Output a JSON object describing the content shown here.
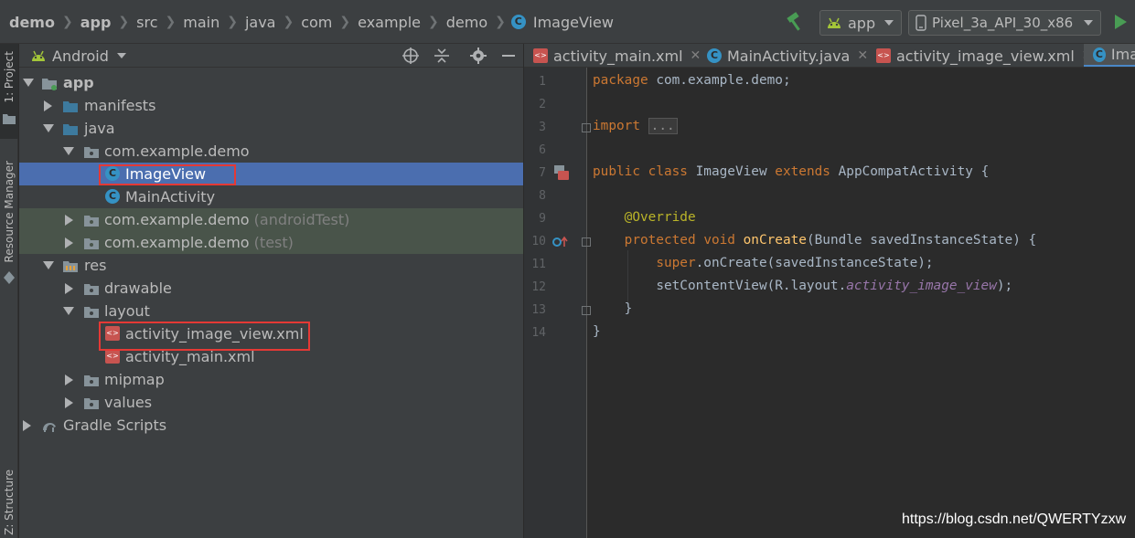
{
  "navbar": {
    "breadcrumbs": [
      "demo",
      "app",
      "src",
      "main",
      "java",
      "com",
      "example",
      "demo"
    ],
    "current_file": "ImageView",
    "run_config": "app",
    "device": "Pixel_3a_API_30_x86"
  },
  "tool_strip": {
    "project_tab": "1: Project",
    "resource_manager_tab": "Resource Manager",
    "structure_tab": "Z: Structure"
  },
  "project_panel": {
    "view_mode": "Android",
    "tree": [
      {
        "label": "app",
        "suffix": ""
      },
      {
        "label": "manifests",
        "suffix": ""
      },
      {
        "label": "java",
        "suffix": ""
      },
      {
        "label": "com.example.demo",
        "suffix": ""
      },
      {
        "label": "ImageView",
        "suffix": ""
      },
      {
        "label": "MainActivity",
        "suffix": ""
      },
      {
        "label": "com.example.demo",
        "suffix": " (androidTest)"
      },
      {
        "label": "com.example.demo",
        "suffix": " (test)"
      },
      {
        "label": "res",
        "suffix": ""
      },
      {
        "label": "drawable",
        "suffix": ""
      },
      {
        "label": "layout",
        "suffix": ""
      },
      {
        "label": "activity_image_view.xml",
        "suffix": ""
      },
      {
        "label": "activity_main.xml",
        "suffix": ""
      },
      {
        "label": "mipmap",
        "suffix": ""
      },
      {
        "label": "values",
        "suffix": ""
      },
      {
        "label": "Gradle Scripts",
        "suffix": ""
      }
    ],
    "selected_item": "ImageView"
  },
  "editor": {
    "tabs": [
      {
        "label": "activity_main.xml",
        "icon": "xml-file-icon"
      },
      {
        "label": "MainActivity.java",
        "icon": "java-class-icon"
      },
      {
        "label": "activity_image_view.xml",
        "icon": "xml-file-icon"
      },
      {
        "label": "Ima",
        "icon": "java-class-icon"
      }
    ],
    "line_numbers": [
      "1",
      "2",
      "3",
      "6",
      "7",
      "8",
      "9",
      "10",
      "11",
      "12",
      "13",
      "14"
    ],
    "code": {
      "l1_kw": "package",
      "l1_rest": " com.example.demo;",
      "l3_kw": "import",
      "l3_fold": "...",
      "l7_kw1": "public",
      "l7_kw2": "class",
      "l7_name": " ImageView ",
      "l7_kw3": "extends",
      "l7_rest": " AppCompatActivity {",
      "l9_ann": "@Override",
      "l10_kw1": "protected",
      "l10_kw2": "void",
      "l10_fn": "onCreate",
      "l10_rest": "(Bundle savedInstanceState) {",
      "l11_kw": "super",
      "l11_rest": ".onCreate(savedInstanceState);",
      "l12_pre": "setContentView(R.layout.",
      "l12_field": "activity_image_view",
      "l12_post": ");",
      "l13": "}",
      "l14": "}"
    }
  },
  "watermark": "https://blog.csdn.net/QWERTYzxw",
  "colors": {
    "background": "#2b2b2b",
    "panel": "#3c3f41",
    "selection": "#4b6eaf",
    "test_source_row": "#49544a",
    "keyword": "#cc7832",
    "annotation": "#bbb529",
    "method": "#ffc66d",
    "field": "#9876aa",
    "highlight_box": "#e53935"
  }
}
